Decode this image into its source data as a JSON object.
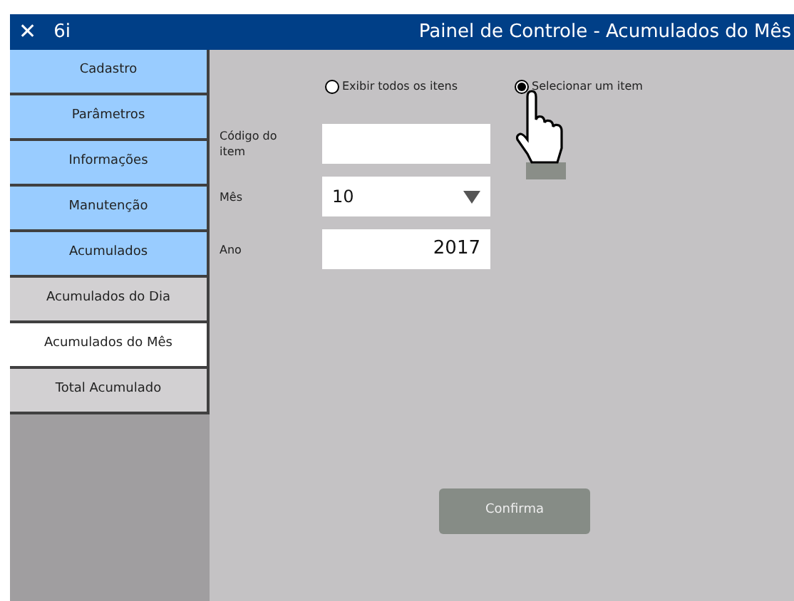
{
  "window": {
    "close_glyph": "✕",
    "app_name": "6i",
    "title": "Painel de Controle - Acumulados do Mês"
  },
  "sidebar": {
    "items": [
      {
        "label": "Cadastro",
        "kind": "category",
        "selected": false
      },
      {
        "label": "Parâmetros",
        "kind": "category",
        "selected": false
      },
      {
        "label": "Informações",
        "kind": "category",
        "selected": false
      },
      {
        "label": "Manutenção",
        "kind": "category",
        "selected": false
      },
      {
        "label": "Acumulados",
        "kind": "category",
        "selected": false
      },
      {
        "label": "Acumulados do Dia",
        "kind": "subitem",
        "selected": false
      },
      {
        "label": "Acumulados do Mês",
        "kind": "subitem",
        "selected": true
      },
      {
        "label": "Total Acumulado",
        "kind": "subitem",
        "selected": false
      }
    ]
  },
  "filter": [
    {
      "label": "Exibir todos os itens",
      "selected": false
    },
    {
      "label": "Selecionar um item",
      "selected": true
    }
  ],
  "fields": [
    {
      "label": "Código do item",
      "kind": "text"
    },
    {
      "label": "Mês",
      "kind": "select",
      "value": "10"
    },
    {
      "label": "Ano",
      "kind": "number",
      "value": "2017"
    }
  ],
  "confirm_button": "Confirma"
}
